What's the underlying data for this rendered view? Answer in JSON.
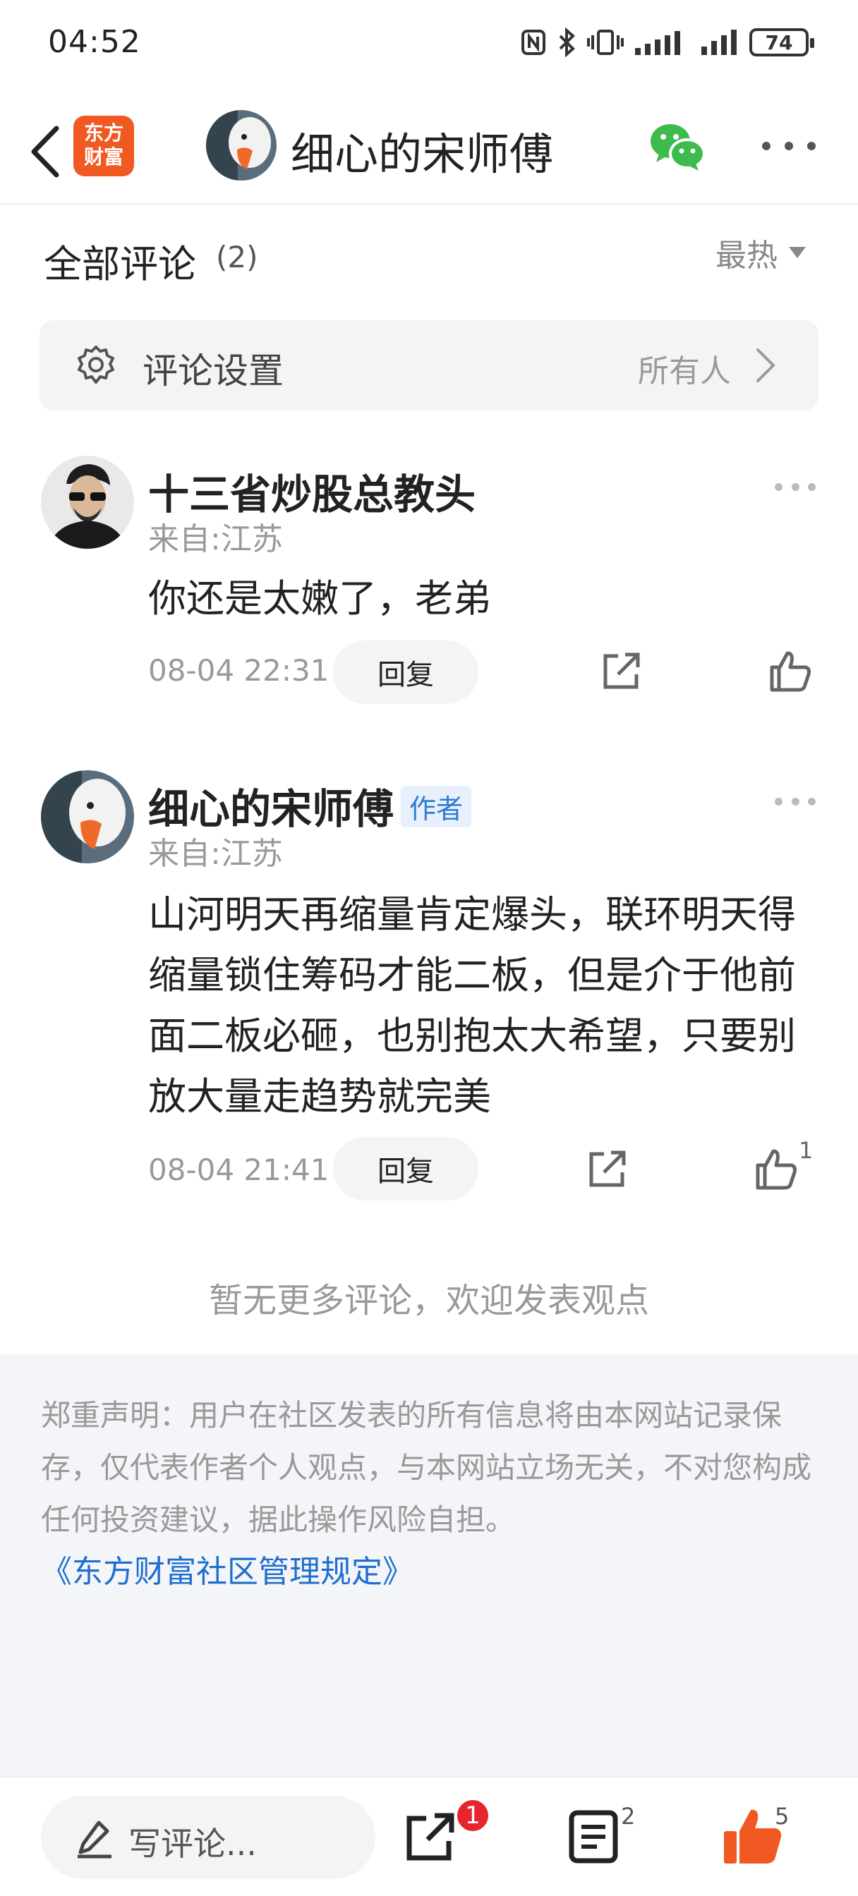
{
  "status_bar": {
    "time": "04:52",
    "battery": "74"
  },
  "nav": {
    "app_logo_line1": "东方",
    "app_logo_line2": "财富",
    "title": "细心的宋师傅"
  },
  "comments_header": {
    "title": "全部评论",
    "count": "(2)",
    "sort_label": "最热"
  },
  "settings": {
    "label": "评论设置",
    "value": "所有人"
  },
  "comments": [
    {
      "name": "十三省炒股总教头",
      "badge": "",
      "location": "来自:江苏",
      "text": "你还是太嫩了，老弟",
      "time": "08-04 22:31",
      "reply_label": "回复",
      "likes": ""
    },
    {
      "name": "细心的宋师傅",
      "badge": "作者",
      "location": "来自:江苏",
      "text": "山河明天再缩量肯定爆头，联环明天得缩量锁住筹码才能二板，但是介于他前面二板必砸，也别抱太大希望，只要别放大量走趋势就完美",
      "time": "08-04 21:41",
      "reply_label": "回复",
      "likes": "1"
    }
  ],
  "end_text": "暂无更多评论，欢迎发表观点",
  "disclaimer": {
    "text": "郑重声明：用户在社区发表的所有信息将由本网站记录保存，仅代表作者个人观点，与本网站立场无关，不对您构成任何投资建议，据此操作风险自担。",
    "link": "《东方财富社区管理规定》"
  },
  "bottom_bar": {
    "write_placeholder": "写评论...",
    "share_badge": "1",
    "list_count": "2",
    "like_count": "5"
  },
  "colors": {
    "accent_orange": "#f05a22",
    "link_blue": "#1e6fd0",
    "badge_red": "#e8242e",
    "wechat_green": "#3dbb4d"
  },
  "icons": [
    "back-arrow-icon",
    "wechat-icon",
    "more-icon",
    "gear-icon",
    "chevron-right-icon",
    "share-icon",
    "thumbs-up-icon",
    "pen-icon",
    "list-icon"
  ]
}
